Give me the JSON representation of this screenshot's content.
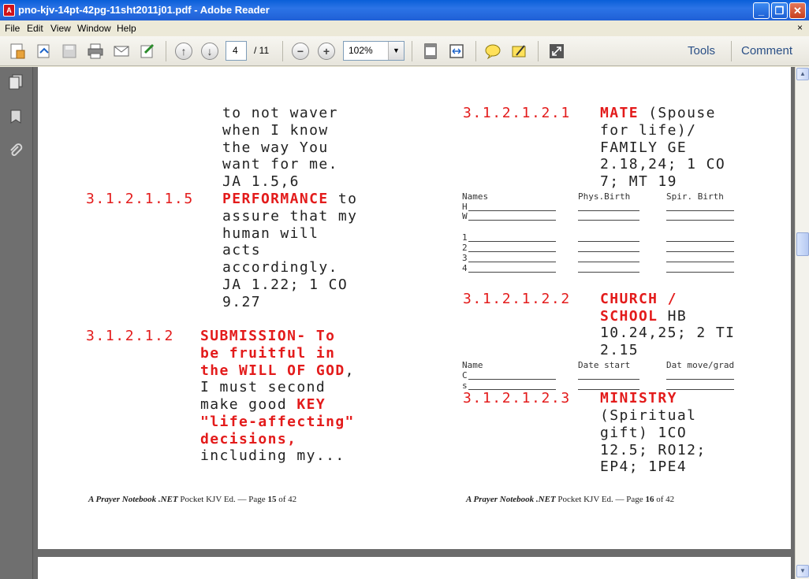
{
  "window": {
    "title": "pno-kjv-14pt-42pg-11sht2011j01.pdf - Adobe Reader",
    "buttons": {
      "minimize": "_",
      "maximize": "❐",
      "close": "✕"
    }
  },
  "menu": [
    "File",
    "Edit",
    "View",
    "Window",
    "Help"
  ],
  "menu_close": "×",
  "toolbar": {
    "page_current": "4",
    "page_total": "/ 11",
    "zoom": "102%",
    "tools_label": "Tools",
    "comment_label": "Comment"
  },
  "left_page": {
    "lines_a": [
      "to not waver",
      "when I  know",
      "the way You",
      "want for me.",
      "JA 1.5,6"
    ],
    "num_115": "3.1.2.1.1.5",
    "perf_title": "PERFORMANCE",
    "perf_rest": " to",
    "lines_b": [
      "assure that my",
      "human will",
      "acts",
      "accordingly.",
      "JA 1.22; 1 CO",
      "9.27"
    ],
    "num_12": "3.1.2.1.2",
    "sub_line1": "SUBMISSION- To",
    "sub_line2": "be fruitful in",
    "sub_line3a": "the WILL OF GOD",
    "sub_line3b": ",",
    "sub_line4": "I must second",
    "sub_line5a": "make good ",
    "sub_line5b": "KEY",
    "sub_line6": "\"life-affecting\"",
    "sub_line7": "decisions,",
    "sub_line8": "including my...",
    "footer_brand": "A Prayer Notebook .NET",
    "footer_text": " Pocket KJV Ed. —  Page ",
    "footer_page": "15",
    "footer_of": " of 42"
  },
  "right_page": {
    "num_1221": "3.1.2.1.2.1",
    "mate_title": "MATE",
    "mate_rest": " (Spouse",
    "mate_lines": [
      "for life)/",
      "FAMILY GE",
      "2.18,24; 1 CO",
      "7; MT 19"
    ],
    "table1_headers": [
      "Names",
      "Phys.Birth",
      "Spir. Birth"
    ],
    "table1_rows": [
      "H",
      "W",
      "",
      "1",
      "2",
      "3",
      "4"
    ],
    "num_1222": "3.1.2.1.2.2",
    "church_line1": "CHURCH /",
    "church_line2a": "SCHOOL",
    "church_line2b": " HB",
    "church_lines": [
      "10.24,25; 2 TI",
      "2.15"
    ],
    "table2_headers": [
      "Name",
      "Date start",
      "Dat move/grad"
    ],
    "table2_rows": [
      "C",
      "s"
    ],
    "num_1223": "3.1.2.1.2.3",
    "ministry_title": "MINISTRY",
    "ministry_lines": [
      "(Spiritual",
      "gift) 1CO",
      "12.5; RO12;",
      "EP4; 1PE4"
    ],
    "footer_brand": "A Prayer Notebook .NET",
    "footer_text": " Pocket KJV Ed. —  Page ",
    "footer_page": "16",
    "footer_of": " of 42"
  }
}
